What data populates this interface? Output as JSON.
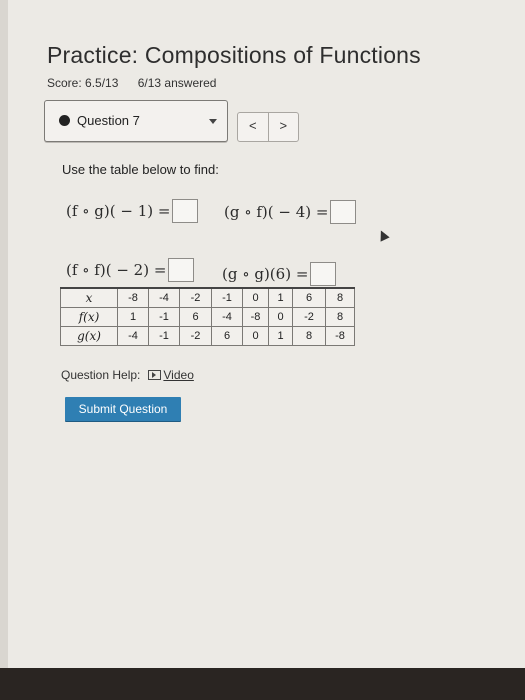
{
  "header": {
    "title": "Practice: Compositions of Functions",
    "score": "Score: 6.5/13",
    "answered": "6/13 answered"
  },
  "question_nav": {
    "selected": "Question 7",
    "prev_label": "<",
    "next_label": ">"
  },
  "prompt": "Use the table below to find:",
  "expressions": [
    {
      "text": "(f ∘ g)( − 1) ="
    },
    {
      "text": "(g ∘ f)( − 4) ="
    },
    {
      "text": "(f ∘ f)( − 2) ="
    },
    {
      "text": "(g ∘ g)(6) ="
    }
  ],
  "table": {
    "row_labels": [
      "x",
      "f(x)",
      "g(x)"
    ],
    "x": [
      "-8",
      "-4",
      "-2",
      "-1",
      "0",
      "1",
      "6",
      "8"
    ],
    "fx": [
      "1",
      "-1",
      "6",
      "-4",
      "-8",
      "0",
      "-2",
      "8"
    ],
    "gx": [
      "-4",
      "-1",
      "-2",
      "6",
      "0",
      "1",
      "8",
      "-8"
    ]
  },
  "help": {
    "label": "Question Help:",
    "video_label": "Video",
    "icon": "video-play-icon"
  },
  "submit_label": "Submit Question"
}
